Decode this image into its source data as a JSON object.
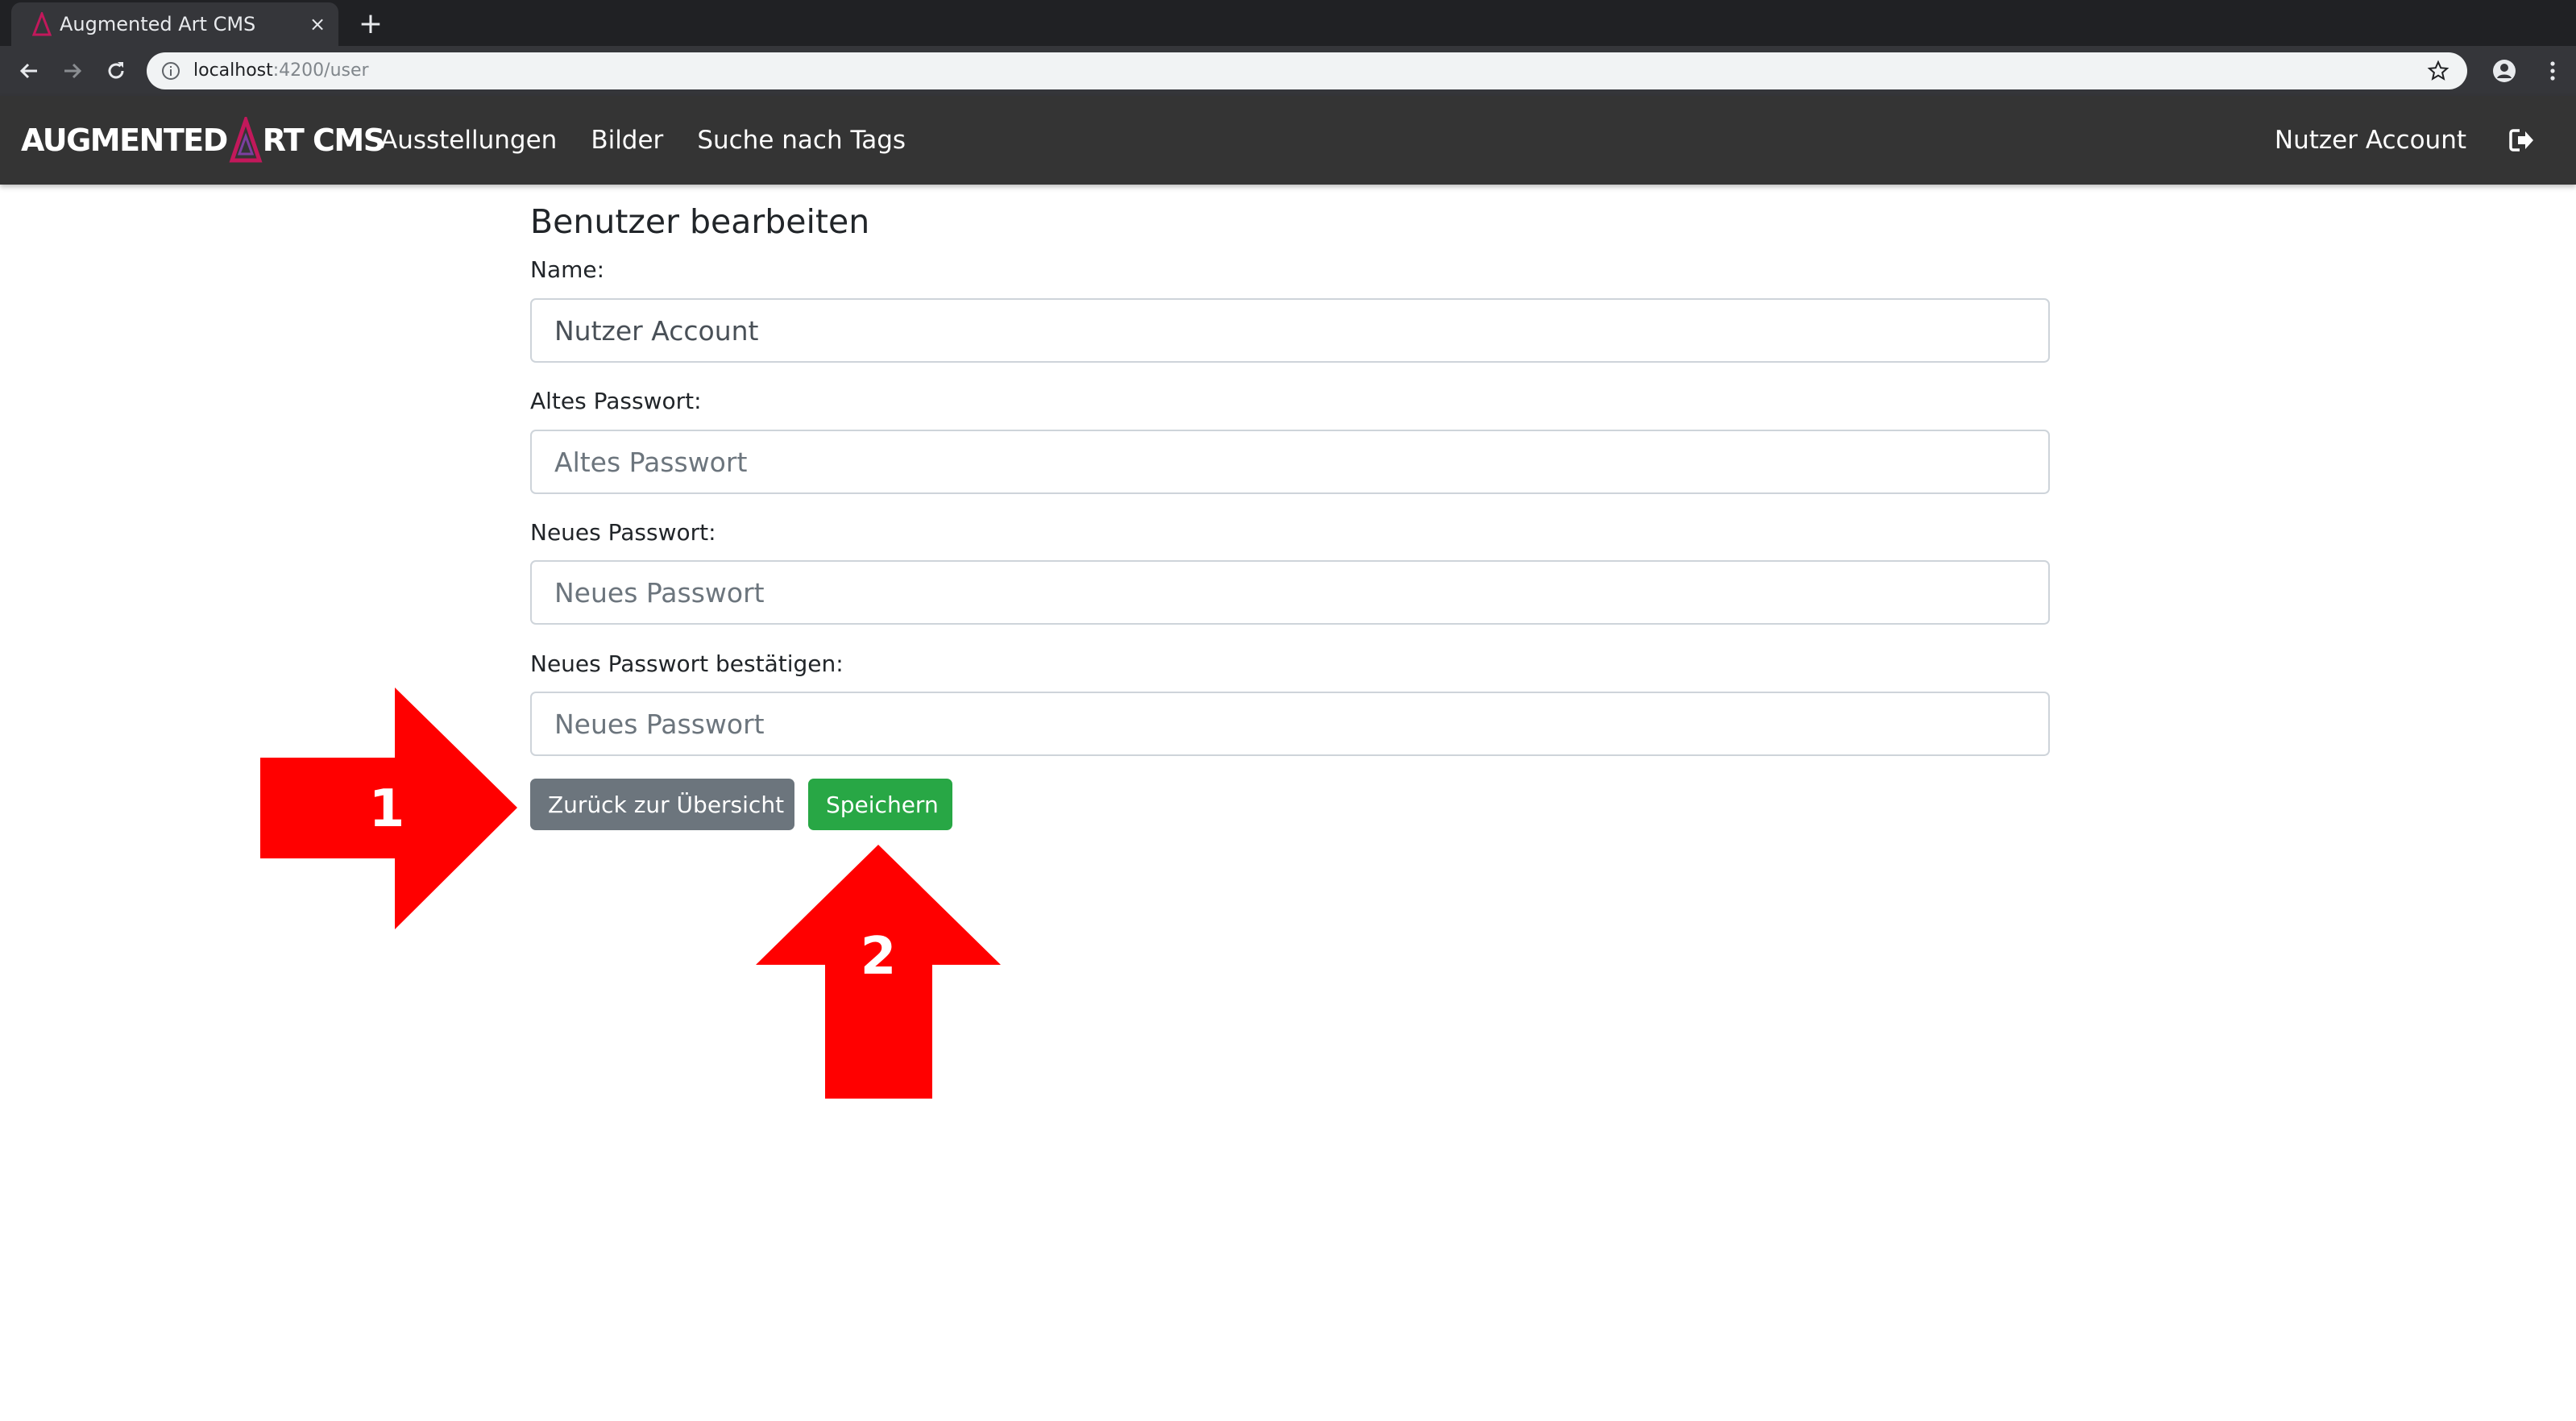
{
  "browser": {
    "tab_title": "Augmented Art CMS",
    "tab_close": "×",
    "new_tab": "+",
    "url_host": "localhost",
    "url_path": ":4200/user"
  },
  "navbar": {
    "brand_part1": "AUGMENTED",
    "brand_part2": "RT CMS",
    "links": [
      "Ausstellungen",
      "Bilder",
      "Suche nach Tags"
    ],
    "user": "Nutzer Account"
  },
  "form": {
    "title": "Benutzer bearbeiten",
    "name_label": "Name:",
    "name_value": "Nutzer Account",
    "old_password_label": "Altes Passwort:",
    "old_password_placeholder": "Altes Passwort",
    "new_password_label": "Neues Passwort:",
    "new_password_placeholder": "Neues Passwort",
    "confirm_password_label": "Neues Passwort bestätigen:",
    "confirm_password_placeholder": "Neues Passwort",
    "back_button": "Zurück zur Übersicht",
    "save_button": "Speichern"
  },
  "annotations": {
    "arrow1_label": "1",
    "arrow2_label": "2",
    "color": "#ff0000"
  },
  "colors": {
    "navbar_bg": "#343434",
    "back_button": "#6c757d",
    "save_button": "#28a745",
    "logo_accent": "#c2185b"
  }
}
